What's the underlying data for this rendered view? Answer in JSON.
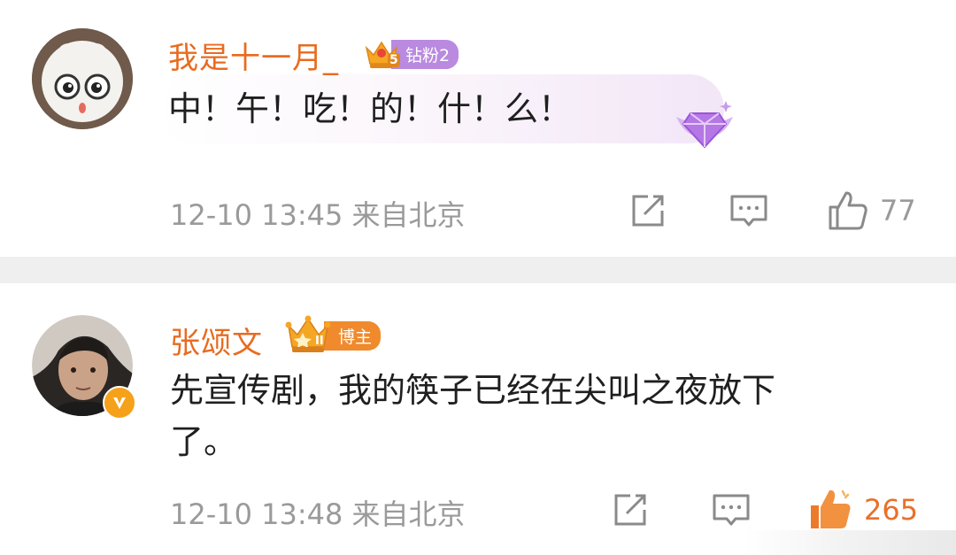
{
  "comments": [
    {
      "username": "我是十一月_",
      "badge_label": "钻粉2",
      "badge_level": "5",
      "text": "中！午！吃！的！什！么！",
      "date": "12-10 13:45",
      "location": "来自北京",
      "likes": "77"
    },
    {
      "username": "张颂文",
      "badge_label": "博主",
      "badge_level": "II",
      "text_line1": "先宣传剧，我的筷子已经在尖叫之夜放下",
      "text_line2": "了。",
      "date": "12-10 13:48",
      "location": "来自北京",
      "likes": "265"
    }
  ],
  "icons": {
    "share": "share-icon",
    "comment": "comment-icon",
    "like": "thumbs-up-icon",
    "verified": "verified-v-icon",
    "crown": "crown-icon",
    "diamond": "diamond-wings-icon"
  },
  "colors": {
    "username": "#e86b1f",
    "meta": "#9a9a9a",
    "badge_purple": "#b98ae0",
    "badge_orange": "#f08a2c",
    "liked_orange": "#e8702a"
  }
}
